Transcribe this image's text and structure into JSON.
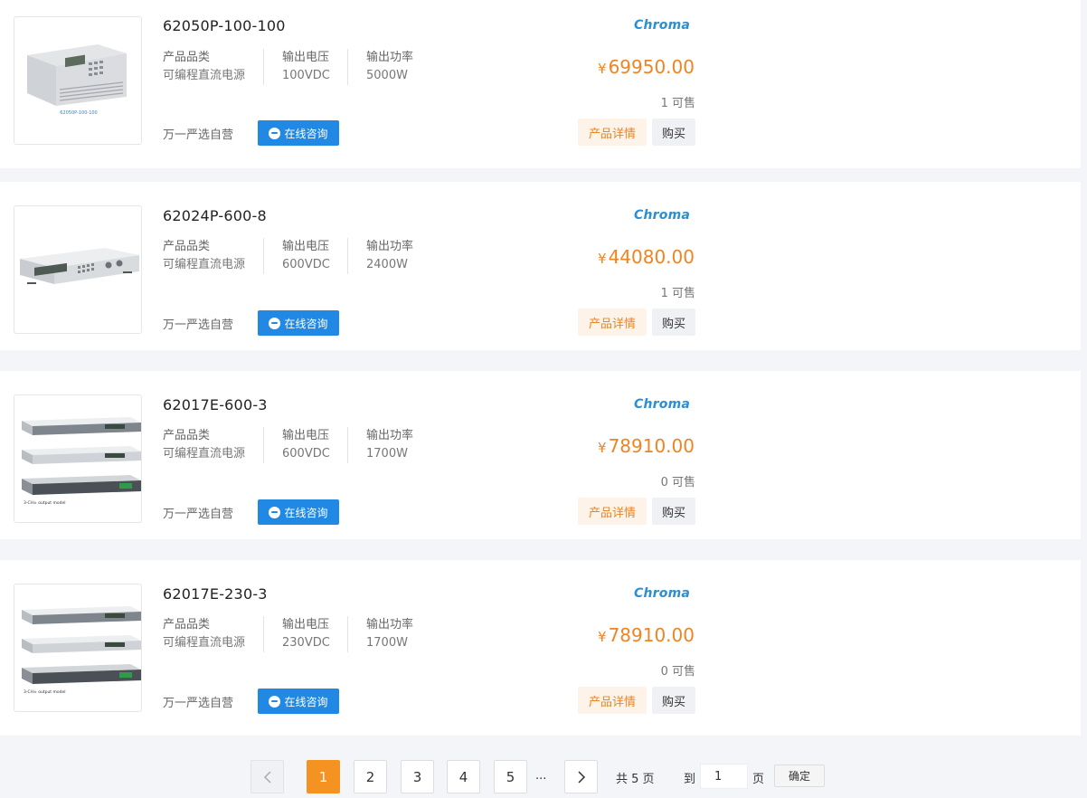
{
  "products": [
    {
      "name": "62050P-100-100",
      "brand": "Chroma",
      "image_caption": "62050P-100-100",
      "specs": [
        {
          "label": "产品品类",
          "value": "可编程直流电源"
        },
        {
          "label": "输出电压",
          "value": "100VDC"
        },
        {
          "label": "输出功率",
          "value": "5000W"
        }
      ],
      "currency": "¥",
      "price": "69950.00",
      "sold": "1 可售",
      "seller": "万一严选自营",
      "consult_label": "在线咨询",
      "detail_label": "产品详情",
      "buy_label": "购买"
    },
    {
      "name": "62024P-600-8",
      "brand": "Chroma",
      "specs": [
        {
          "label": "产品品类",
          "value": "可编程直流电源"
        },
        {
          "label": "输出电压",
          "value": "600VDC"
        },
        {
          "label": "输出功率",
          "value": "2400W"
        }
      ],
      "currency": "¥",
      "price": "44080.00",
      "sold": "1 可售",
      "seller": "万一严选自营",
      "consult_label": "在线咨询",
      "detail_label": "产品详情",
      "buy_label": "购买"
    },
    {
      "name": "62017E-600-3",
      "brand": "Chroma",
      "image_caption": "3-CH± output model",
      "specs": [
        {
          "label": "产品品类",
          "value": "可编程直流电源"
        },
        {
          "label": "输出电压",
          "value": "600VDC"
        },
        {
          "label": "输出功率",
          "value": "1700W"
        }
      ],
      "currency": "¥",
      "price": "78910.00",
      "sold": "0 可售",
      "seller": "万一严选自营",
      "consult_label": "在线咨询",
      "detail_label": "产品详情",
      "buy_label": "购买"
    },
    {
      "name": "62017E-230-3",
      "brand": "Chroma",
      "image_caption": "3-CH± output model",
      "specs": [
        {
          "label": "产品品类",
          "value": "可编程直流电源"
        },
        {
          "label": "输出电压",
          "value": "230VDC"
        },
        {
          "label": "输出功率",
          "value": "1700W"
        }
      ],
      "currency": "¥",
      "price": "78910.00",
      "sold": "0 可售",
      "seller": "万一严选自营",
      "consult_label": "在线咨询",
      "detail_label": "产品详情",
      "buy_label": "购买"
    }
  ],
  "pagination": {
    "pages": [
      "1",
      "2",
      "3",
      "4",
      "5"
    ],
    "current": "1",
    "ellipsis": "...",
    "total_text": "共 5 页",
    "goto_prefix": "到",
    "goto_value": "1",
    "goto_suffix": "页",
    "confirm_label": "确定"
  },
  "colors": {
    "accent_orange": "#ef8423",
    "accent_blue": "#2189e3",
    "brand_blue": "#2b8fd1",
    "page_bg": "#f4f5f9"
  }
}
